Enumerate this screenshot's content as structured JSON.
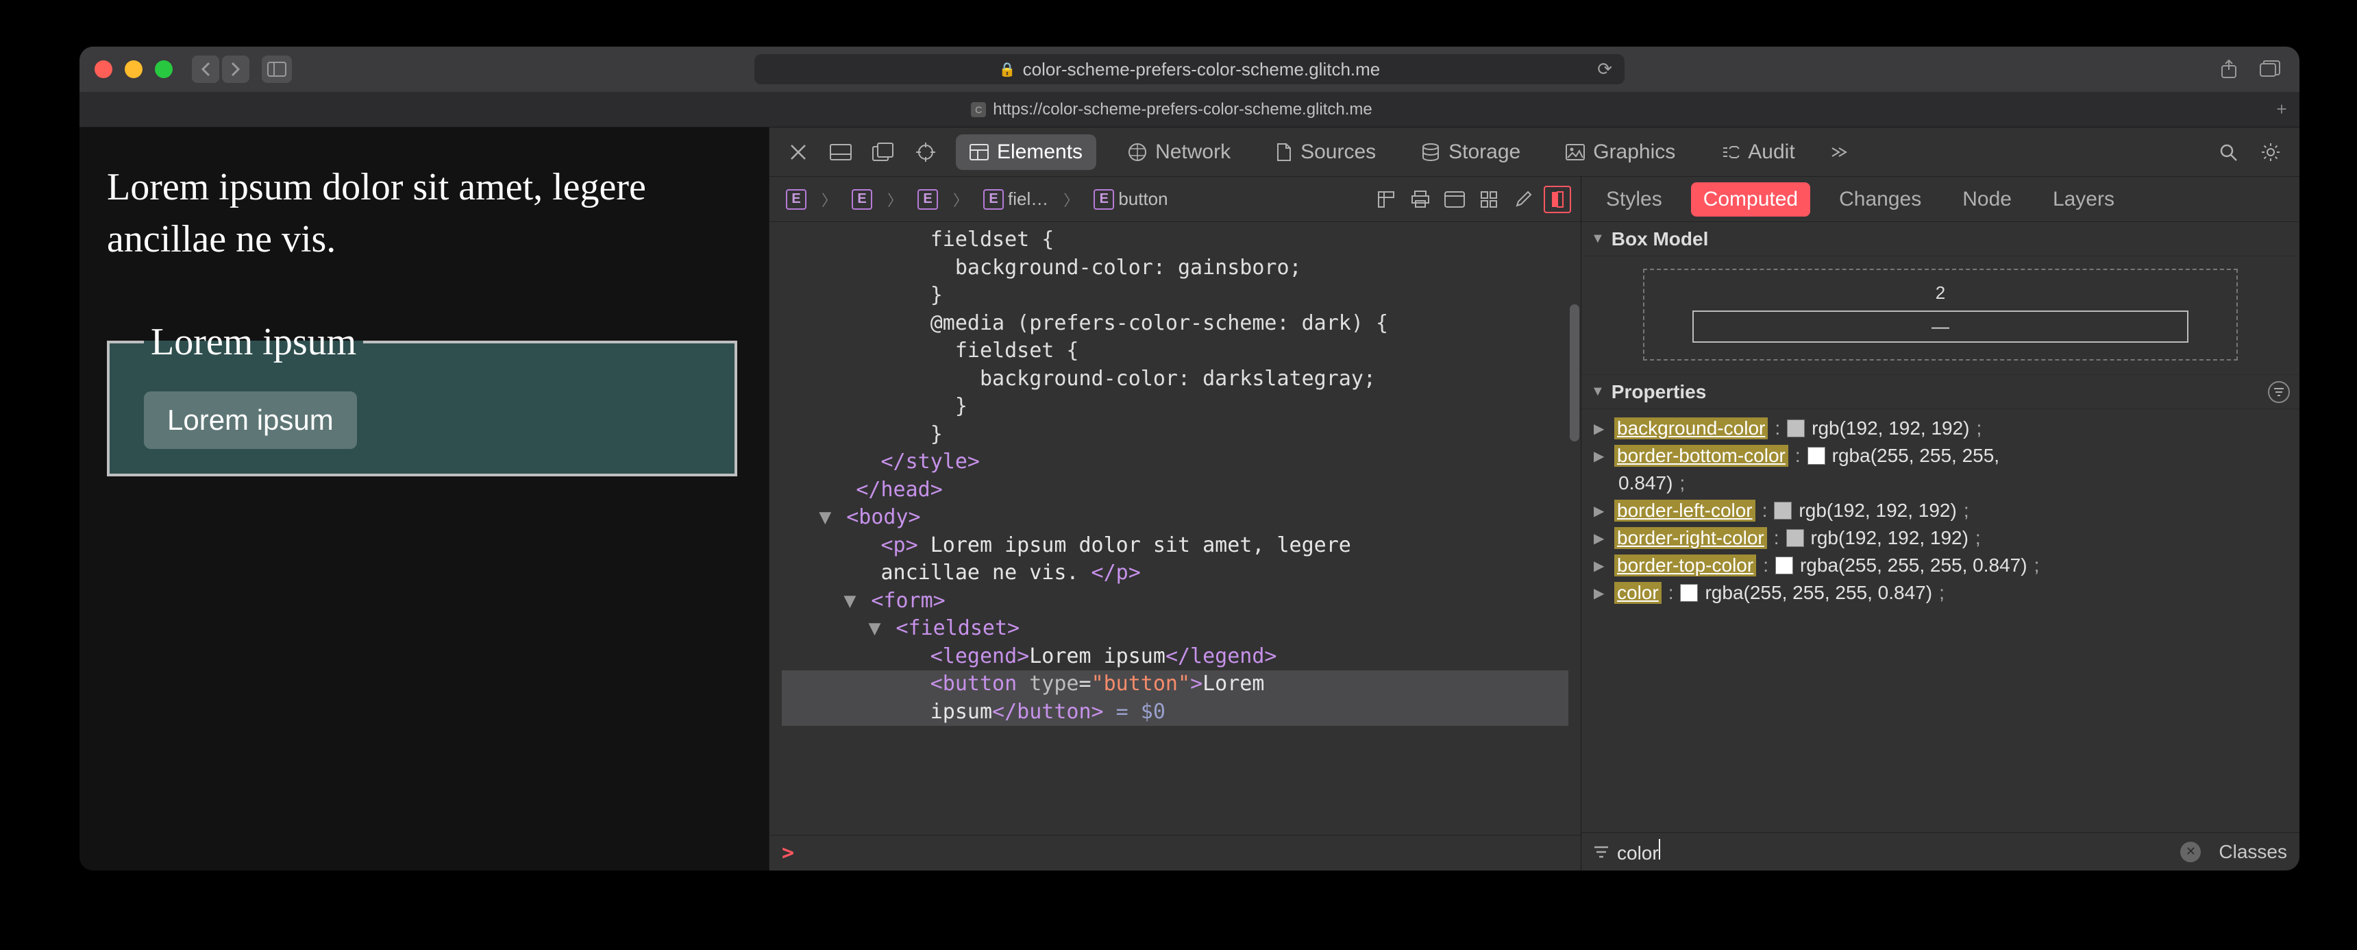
{
  "browser": {
    "url_host": "color-scheme-prefers-color-scheme.glitch.me",
    "tab_title": "https://color-scheme-prefers-color-scheme.glitch.me",
    "tab_favicon_letter": "C",
    "new_tab_glyph": "+"
  },
  "page": {
    "paragraph": "Lorem ipsum dolor sit amet, legere ancillae ne vis.",
    "legend": "Lorem ipsum",
    "button": "Lorem ipsum"
  },
  "devtools": {
    "tabs": [
      "Elements",
      "Network",
      "Sources",
      "Storage",
      "Graphics",
      "Audit"
    ],
    "active_tab": "Elements",
    "breadcrumb": [
      "",
      "",
      "",
      "fiel…",
      "button"
    ],
    "source_lines": [
      "            fieldset {",
      "              background-color: gainsboro;",
      "            }",
      "            @media (prefers-color-scheme: dark) {",
      "              fieldset {",
      "                background-color: darkslategray;",
      "              }",
      "            }",
      "        </style>",
      "      </head>",
      "      <body>",
      "        <p> Lorem ipsum dolor sit amet, legere",
      "        ancillae ne vis. </p>",
      "        <form>",
      "          <fieldset>",
      "            <legend>Lorem ipsum</legend>",
      "            <button type=\"button\">Lorem",
      "            ipsum</button> = $0"
    ],
    "console_prompt": ">"
  },
  "styles_pane": {
    "tabs": [
      "Styles",
      "Computed",
      "Changes",
      "Node",
      "Layers"
    ],
    "active_tab": "Computed",
    "box_model_section": "Box Model",
    "box_model_top": "2",
    "box_model_inner": "—",
    "properties_section": "Properties",
    "props": [
      {
        "name": "background-color",
        "value": "rgb(192, 192, 192)",
        "swatch": "#c0c0c0"
      },
      {
        "name": "border-bottom-color",
        "value": "rgba(255, 255, 255, 0.847)",
        "swatch": "#ffffff"
      },
      {
        "name": "border-left-color",
        "value": "rgb(192, 192, 192)",
        "swatch": "#c0c0c0"
      },
      {
        "name": "border-right-color",
        "value": "rgb(192, 192, 192)",
        "swatch": "#c0c0c0"
      },
      {
        "name": "border-top-color",
        "value": "rgba(255, 255, 255, 0.847)",
        "swatch": "#ffffff"
      },
      {
        "name": "color",
        "value": "rgba(255, 255, 255, 0.847)",
        "swatch": "#ffffff"
      }
    ],
    "filter_value": "color",
    "classes_label": "Classes"
  }
}
